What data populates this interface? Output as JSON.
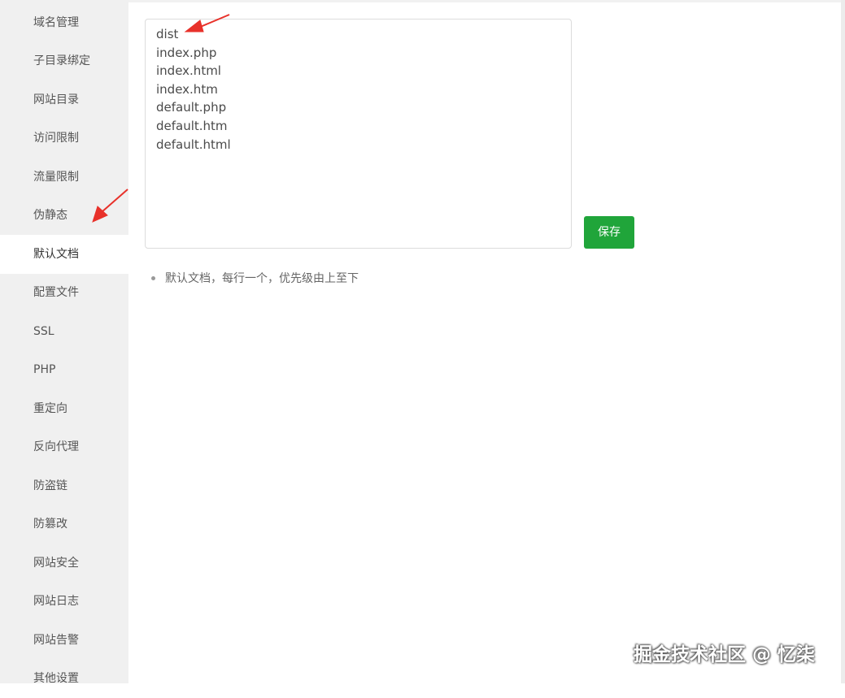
{
  "sidebar": {
    "items": [
      {
        "label": "域名管理"
      },
      {
        "label": "子目录绑定"
      },
      {
        "label": "网站目录"
      },
      {
        "label": "访问限制"
      },
      {
        "label": "流量限制"
      },
      {
        "label": "伪静态"
      },
      {
        "label": "默认文档",
        "active": true
      },
      {
        "label": "配置文件"
      },
      {
        "label": "SSL"
      },
      {
        "label": "PHP"
      },
      {
        "label": "重定向"
      },
      {
        "label": "反向代理"
      },
      {
        "label": "防盗链"
      },
      {
        "label": "防篡改"
      },
      {
        "label": "网站安全"
      },
      {
        "label": "网站日志"
      },
      {
        "label": "网站告警"
      },
      {
        "label": "其他设置"
      }
    ]
  },
  "editor": {
    "lines": [
      "dist",
      "index.php",
      "index.html",
      "index.htm",
      "default.php",
      "default.htm",
      "default.html"
    ]
  },
  "save_button": {
    "label": "保存"
  },
  "tip": {
    "text": "默认文档，每行一个，优先级由上至下"
  },
  "watermark": {
    "text": "掘金技术社区 @ 忆柒"
  },
  "colors": {
    "accent": "#20a53a",
    "annotation_arrow": "#e8312a"
  },
  "icons": [
    "red-arrow-annotation-icon"
  ]
}
